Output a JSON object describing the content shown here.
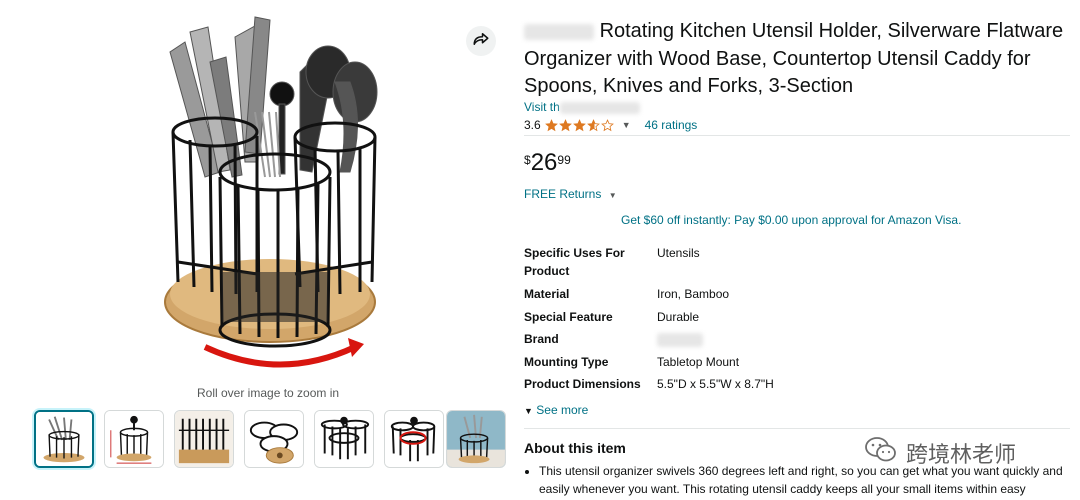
{
  "product": {
    "brand_blurred": "",
    "title": "Rotating Kitchen Utensil Holder, Silverware Flatware Organizer with Wood Base, Countertop Utensil Caddy for Spoons, Knives and Forks, 3-Section",
    "visit_prefix": "Visit th",
    "rating_value": "3.6",
    "rating_stars": 3.6,
    "ratings_count": "46 ratings",
    "price": {
      "symbol": "$",
      "whole": "26",
      "fraction": "99"
    },
    "returns": "FREE Returns",
    "promo": "Get $60 off instantly: Pay $0.00 upon approval for Amazon Visa.",
    "specs": [
      {
        "key": "Specific Uses For Product",
        "value": "Utensils"
      },
      {
        "key": "Material",
        "value": "Iron, Bamboo"
      },
      {
        "key": "Special Feature",
        "value": "Durable"
      },
      {
        "key": "Brand",
        "value": ""
      },
      {
        "key": "Mounting Type",
        "value": "Tabletop Mount"
      },
      {
        "key": "Product Dimensions",
        "value": "5.5\"D x 5.5\"W x 8.7\"H"
      }
    ],
    "see_more": "See more",
    "about_title": "About this item",
    "about_bullet": "This utensil organizer swivels 360 degrees left and right, so you can get what you want quickly and easily whenever you want. This rotating utensil caddy keeps all your small items within easy"
  },
  "gallery": {
    "zoom_hint": "Roll over image to zoom in",
    "thumbnail_count": 7,
    "active_index": 0
  },
  "watermark": {
    "text": "跨境林老师"
  },
  "colors": {
    "link": "#007185",
    "star": "#de7921",
    "text": "#0f1111"
  }
}
